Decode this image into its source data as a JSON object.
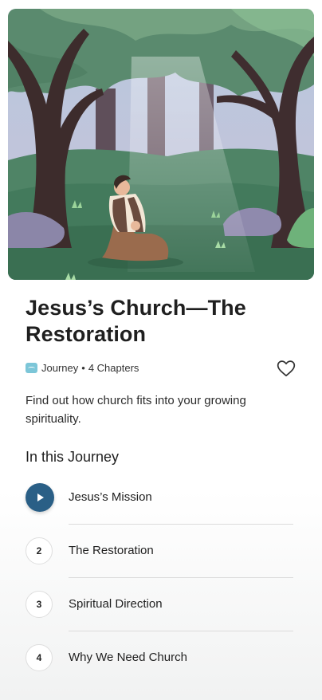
{
  "journey": {
    "title": "Jesus’s Church—The Restoration",
    "type_label": "Journey",
    "separator": "•",
    "chapter_count": "4 Chapters",
    "description": "Find out how church fits into your growing spirituality.",
    "section_title": "In this Journey",
    "chapters": [
      {
        "number": "",
        "label": "Jesus’s Mission",
        "state": "play"
      },
      {
        "number": "2",
        "label": "The Restoration"
      },
      {
        "number": "3",
        "label": "Spiritual Direction"
      },
      {
        "number": "4",
        "label": "Why We Need Church"
      }
    ]
  },
  "icons": {
    "favorite": "heart-outline-icon",
    "play": "play-icon",
    "journey": "journey-icon"
  },
  "colors": {
    "accent": "#2a5f86",
    "journey_badge": "#7cc6d8"
  }
}
